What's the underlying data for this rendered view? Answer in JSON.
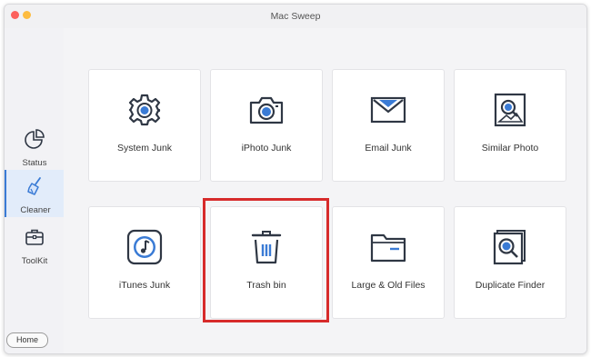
{
  "window": {
    "title": "Mac Sweep"
  },
  "sidebar": {
    "items": [
      {
        "label": "Status",
        "icon": "pie-chart-icon"
      },
      {
        "label": "Cleaner",
        "icon": "broom-icon",
        "active": true
      },
      {
        "label": "ToolKit",
        "icon": "toolbox-icon"
      }
    ],
    "home_label": "Home"
  },
  "cards": [
    {
      "label": "System Junk",
      "icon": "gear-icon"
    },
    {
      "label": "iPhoto Junk",
      "icon": "camera-icon"
    },
    {
      "label": "Email Junk",
      "icon": "envelope-icon"
    },
    {
      "label": "Similar Photo",
      "icon": "image-search-icon"
    },
    {
      "label": "iTunes Junk",
      "icon": "music-icon"
    },
    {
      "label": "Trash bin",
      "icon": "trash-icon",
      "highlighted": true
    },
    {
      "label": "Large & Old Files",
      "icon": "folder-icon"
    },
    {
      "label": "Duplicate Finder",
      "icon": "duplicate-search-icon"
    }
  ],
  "colors": {
    "accent": "#3a7bd5",
    "highlight": "#d72b2b",
    "icon_dark": "#2f3744"
  }
}
